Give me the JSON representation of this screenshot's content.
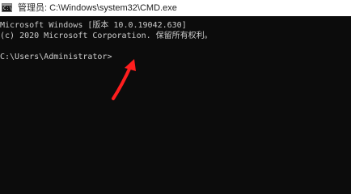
{
  "window": {
    "title": "管理员: C:\\Windows\\system32\\CMD.exe",
    "icon_label": "C:\\",
    "icon": "console-icon"
  },
  "console": {
    "lines": [
      "Microsoft Windows [版本 10.0.19042.630]",
      "(c) 2020 Microsoft Corporation. 保留所有权利。",
      "C:\\Users\\Administrator>"
    ]
  },
  "annotation": {
    "icon": "red-arrow-icon",
    "color": "#ff1e1e"
  },
  "colors": {
    "background": "#0c0c0c",
    "text": "#cccccc",
    "titlebar": "#ffffff"
  }
}
